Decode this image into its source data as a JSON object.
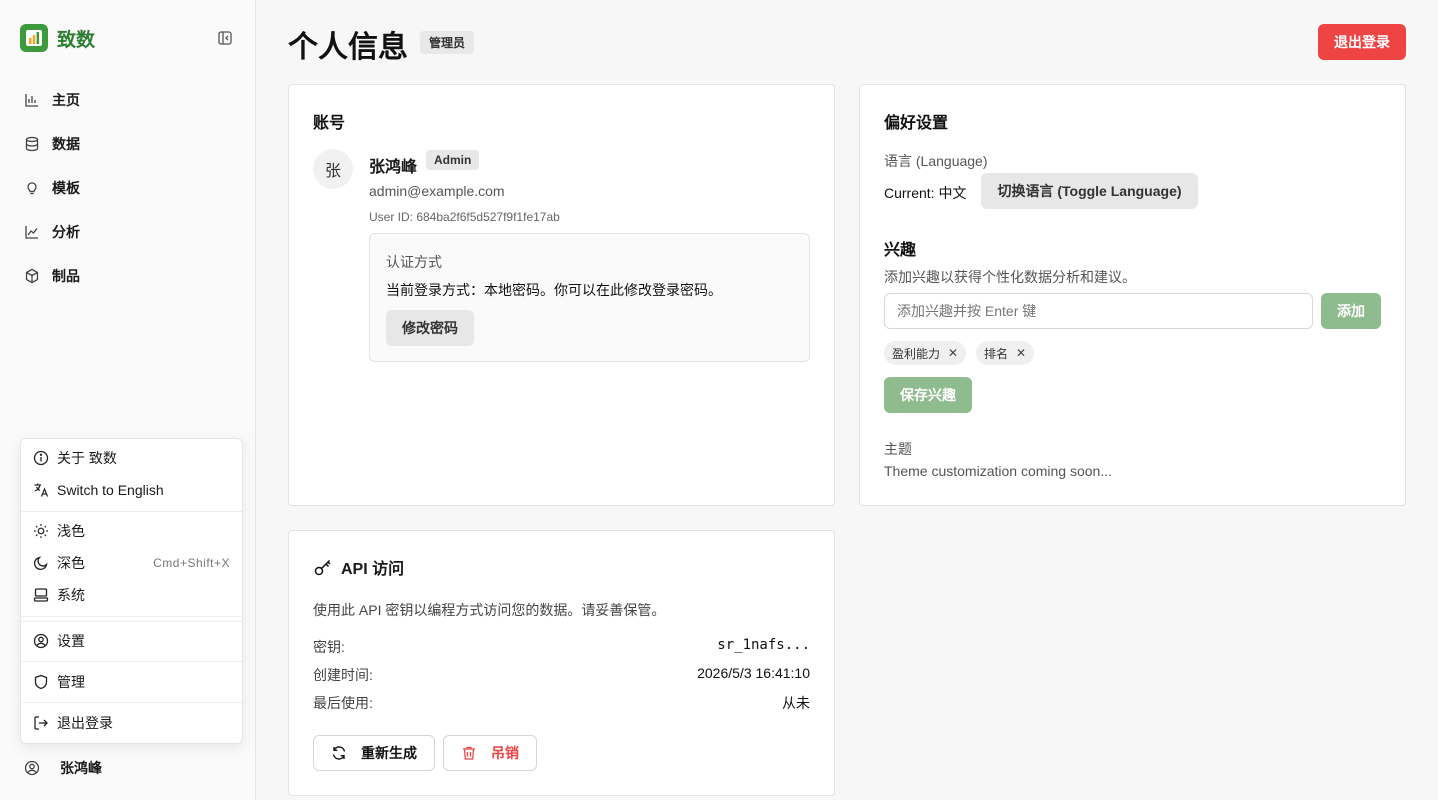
{
  "app": {
    "name": "致数"
  },
  "nav": {
    "items": [
      {
        "label": "主页",
        "icon": "bar-chart-icon"
      },
      {
        "label": "数据",
        "icon": "database-icon"
      },
      {
        "label": "模板",
        "icon": "lightbulb-icon"
      },
      {
        "label": "分析",
        "icon": "line-chart-icon"
      },
      {
        "label": "制品",
        "icon": "cube-icon"
      }
    ]
  },
  "menu": {
    "about": "关于 致数",
    "switch_lang": "Switch to English",
    "light": "浅色",
    "dark": "深色",
    "dark_shortcut": "Cmd+Shift+X",
    "system": "系统",
    "settings": "设置",
    "admin": "管理",
    "logout": "退出登录"
  },
  "user": {
    "name": "张鸿峰"
  },
  "page": {
    "title": "个人信息",
    "role_badge": "管理员",
    "logout_button": "退出登录"
  },
  "account": {
    "title": "账号",
    "avatar_initial": "张",
    "name": "张鸿峰",
    "badge": "Admin",
    "email": "admin@example.com",
    "user_id": "User ID: 684ba2f6f5d527f9f1fe17ab",
    "auth_title": "认证方式",
    "auth_desc": "当前登录方式：本地密码。你可以在此修改登录密码。",
    "change_password": "修改密码"
  },
  "preferences": {
    "title": "偏好设置",
    "language_label": "语言 (Language)",
    "current_language": "Current: 中文",
    "toggle_language": "切换语言 (Toggle Language)",
    "interests_title": "兴趣",
    "interests_desc": "添加兴趣以获得个性化数据分析和建议。",
    "interest_placeholder": "添加兴趣并按 Enter 键",
    "interest_value": "",
    "add_button": "添加",
    "tags": [
      "盈利能力",
      "排名"
    ],
    "save_button": "保存兴趣",
    "theme_label": "主题",
    "theme_desc": "Theme customization coming soon..."
  },
  "api": {
    "title": "API 访问",
    "desc": "使用此 API 密钥以编程方式访问您的数据。请妥善保管。",
    "key_label": "密钥:",
    "key_value": "sr_1nafs...",
    "created_label": "创建时间:",
    "created_value": "2026/5/3 16:41:10",
    "last_used_label": "最后使用:",
    "last_used_value": "从未",
    "regenerate_button": "重新生成",
    "revoke_button": "吊销"
  },
  "colors": {
    "brand_green": "#3c9a3c",
    "danger_red": "#ef4444",
    "muted_green": "#8fbc8f"
  }
}
